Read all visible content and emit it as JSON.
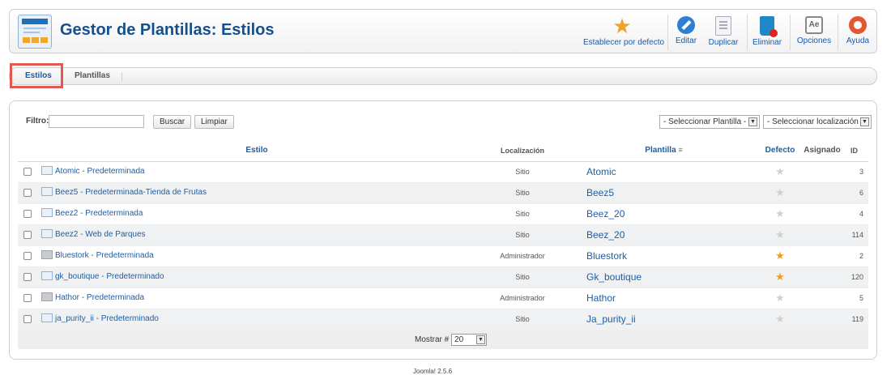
{
  "header": {
    "title": "Gestor de Plantillas: Estilos",
    "toolbar": [
      {
        "key": "default",
        "label": "Establecer por defecto",
        "icon": "star-icon"
      },
      {
        "key": "edit",
        "label": "Editar",
        "icon": "pencil-icon"
      },
      {
        "key": "duplicate",
        "label": "Duplicar",
        "icon": "duplicate-icon"
      },
      {
        "key": "delete",
        "label": "Eliminar",
        "icon": "trash-icon"
      },
      {
        "key": "options",
        "label": "Opciones",
        "icon": "options-icon"
      },
      {
        "key": "help",
        "label": "Ayuda",
        "icon": "help-icon"
      }
    ]
  },
  "tabs": [
    {
      "label": "Estilos",
      "active": true
    },
    {
      "label": "Plantillas",
      "active": false
    }
  ],
  "filter": {
    "label": "Filtro:",
    "value": "",
    "search_label": "Buscar",
    "clear_label": "Limpiar",
    "template_select": "- Seleccionar Plantilla -",
    "location_select": "- Seleccionar localización -"
  },
  "table": {
    "headers": {
      "estilo": "Estilo",
      "localizacion": "Localización",
      "plantilla": "Plantilla",
      "defecto": "Defecto",
      "asignado": "Asignado",
      "id": "ID"
    },
    "rows": [
      {
        "estilo": "Atomic - Predeterminada",
        "loc": "Sitio",
        "plantilla": "Atomic",
        "default": false,
        "id": "3"
      },
      {
        "estilo": "Beez5 - Predeterminada-Tienda de Frutas",
        "loc": "Sitio",
        "plantilla": "Beez5",
        "default": false,
        "id": "6"
      },
      {
        "estilo": "Beez2 - Predeterminada",
        "loc": "Sitio",
        "plantilla": "Beez_20",
        "default": false,
        "id": "4"
      },
      {
        "estilo": "Beez2 - Web de Parques",
        "loc": "Sitio",
        "plantilla": "Beez_20",
        "default": false,
        "id": "114"
      },
      {
        "estilo": "Bluestork - Predeterminada",
        "loc": "Administrador",
        "plantilla": "Bluestork",
        "default": true,
        "id": "2"
      },
      {
        "estilo": "gk_boutique - Predeterminado",
        "loc": "Sitio",
        "plantilla": "Gk_boutique",
        "default": true,
        "id": "120"
      },
      {
        "estilo": "Hathor - Predeterminada",
        "loc": "Administrador",
        "plantilla": "Hathor",
        "default": false,
        "id": "5"
      },
      {
        "estilo": "ja_purity_ii - Predeterminado",
        "loc": "Sitio",
        "plantilla": "Ja_purity_ii",
        "default": false,
        "id": "119"
      }
    ]
  },
  "pagination": {
    "label": "Mostrar #",
    "value": "20"
  },
  "footer": {
    "version": "Joomla! 2.5.6"
  }
}
